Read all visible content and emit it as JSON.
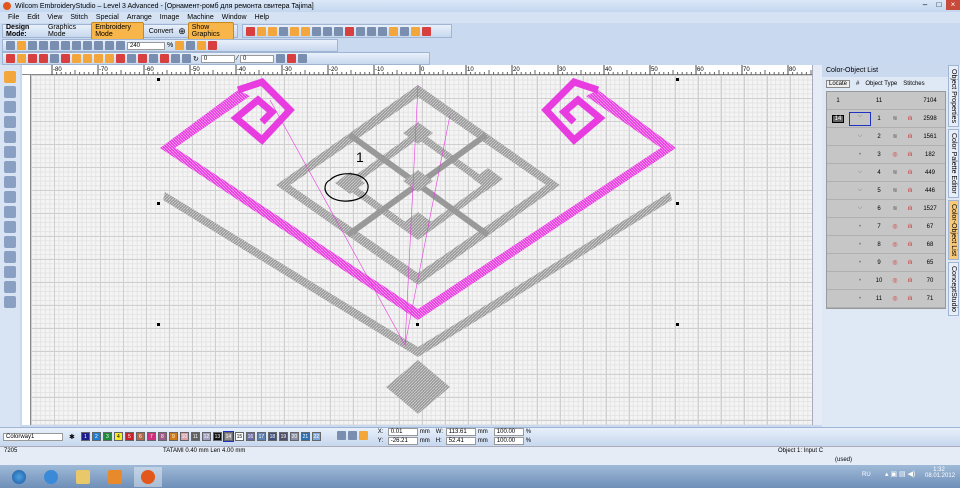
{
  "window": {
    "title": "Wilcom EmbroideryStudio – Level 3 Advanced - [Орнамент-ромб для ремонта свитера        Tajima]"
  },
  "menu": [
    "File",
    "Edit",
    "View",
    "Stitch",
    "Special",
    "Arrange",
    "Image",
    "Machine",
    "Window",
    "Help"
  ],
  "toolbar": {
    "design_mode_label": "Design Mode:",
    "graphics_mode": "Graphics Mode",
    "embroidery_mode": "Embroidery Mode",
    "convert": "Convert",
    "show_graphics": "Show Graphics",
    "zoom_value": "240",
    "zoom_unit": "%",
    "angle1": "0",
    "angle2": "0"
  },
  "ruler": {
    "top_labels": [
      "-80",
      "-70",
      "-60",
      "-50",
      "-40",
      "-30",
      "-20",
      "-10",
      "0",
      "10",
      "20",
      "30",
      "40",
      "50",
      "60",
      "70",
      "80"
    ]
  },
  "canvas": {
    "annotation": "1",
    "accent_pink": "#e83ce0",
    "stitch_gray": "#8a8a8a"
  },
  "panel": {
    "title": "Color-Object List",
    "locate": "Locate",
    "col_num": "#",
    "col_type": "Object Type",
    "col_stitches": "Stitches",
    "summary": {
      "colors": "1",
      "objects": "11",
      "stitches": "7104"
    },
    "color_block": "14",
    "rows": [
      {
        "n": "1",
        "s": "2598",
        "t": "satin"
      },
      {
        "n": "2",
        "s": "1561",
        "t": "satin"
      },
      {
        "n": "3",
        "s": "182",
        "t": "run"
      },
      {
        "n": "4",
        "s": "449",
        "t": "satin"
      },
      {
        "n": "5",
        "s": "446",
        "t": "satin"
      },
      {
        "n": "6",
        "s": "1527",
        "t": "satin"
      },
      {
        "n": "7",
        "s": "67",
        "t": "run"
      },
      {
        "n": "8",
        "s": "68",
        "t": "run"
      },
      {
        "n": "9",
        "s": "65",
        "t": "run"
      },
      {
        "n": "10",
        "s": "70",
        "t": "run"
      },
      {
        "n": "11",
        "s": "71",
        "t": "run"
      }
    ]
  },
  "sidetabs": [
    "Object Properties",
    "Color Palette Editor",
    "Color-Object List",
    "ConceptStudio"
  ],
  "colorway": {
    "name": "Colorway1",
    "swatches": [
      {
        "n": "1",
        "c": "#1d1d8a"
      },
      {
        "n": "2",
        "c": "#1e7fd0"
      },
      {
        "n": "3",
        "c": "#1f8a3a"
      },
      {
        "n": "4",
        "c": "#f2ea2a"
      },
      {
        "n": "5",
        "c": "#c8222a"
      },
      {
        "n": "6",
        "c": "#b06a4a"
      },
      {
        "n": "7",
        "c": "#d0307a"
      },
      {
        "n": "8",
        "c": "#a05a8a"
      },
      {
        "n": "9",
        "c": "#d07a18"
      },
      {
        "n": "10",
        "c": "#d8a0a8"
      },
      {
        "n": "11",
        "c": "#606060"
      },
      {
        "n": "12",
        "c": "#a0a0c0"
      },
      {
        "n": "13",
        "c": "#101010"
      },
      {
        "n": "14",
        "c": "#909090"
      },
      {
        "n": "15",
        "c": "#ffffff"
      },
      {
        "n": "16",
        "c": "#6a6aa8"
      },
      {
        "n": "17",
        "c": "#6080b0"
      },
      {
        "n": "18",
        "c": "#405080"
      },
      {
        "n": "19",
        "c": "#505068"
      },
      {
        "n": "20",
        "c": "#8890a8"
      },
      {
        "n": "21",
        "c": "#2c70b0"
      },
      {
        "n": "22",
        "c": "#7fa8d8"
      }
    ]
  },
  "coords": {
    "x_label": "X:",
    "x": "0.01",
    "y_label": "Y:",
    "y": "-26.21",
    "w_label": "W:",
    "w": "113.61",
    "h_label": "H:",
    "h": "52.41",
    "unit": "mm",
    "w_pct": "100.00",
    "h_pct": "100.00",
    "pct": "%"
  },
  "status": {
    "stitch_count": "7205",
    "stitch_info": "TATAMI 0.40 mm Len  4.00 mm",
    "object": "Object 1: Input C",
    "used": "(used)"
  },
  "taskbar": {
    "lang": "RU",
    "time": "1:32",
    "date": "08.01.2012"
  }
}
